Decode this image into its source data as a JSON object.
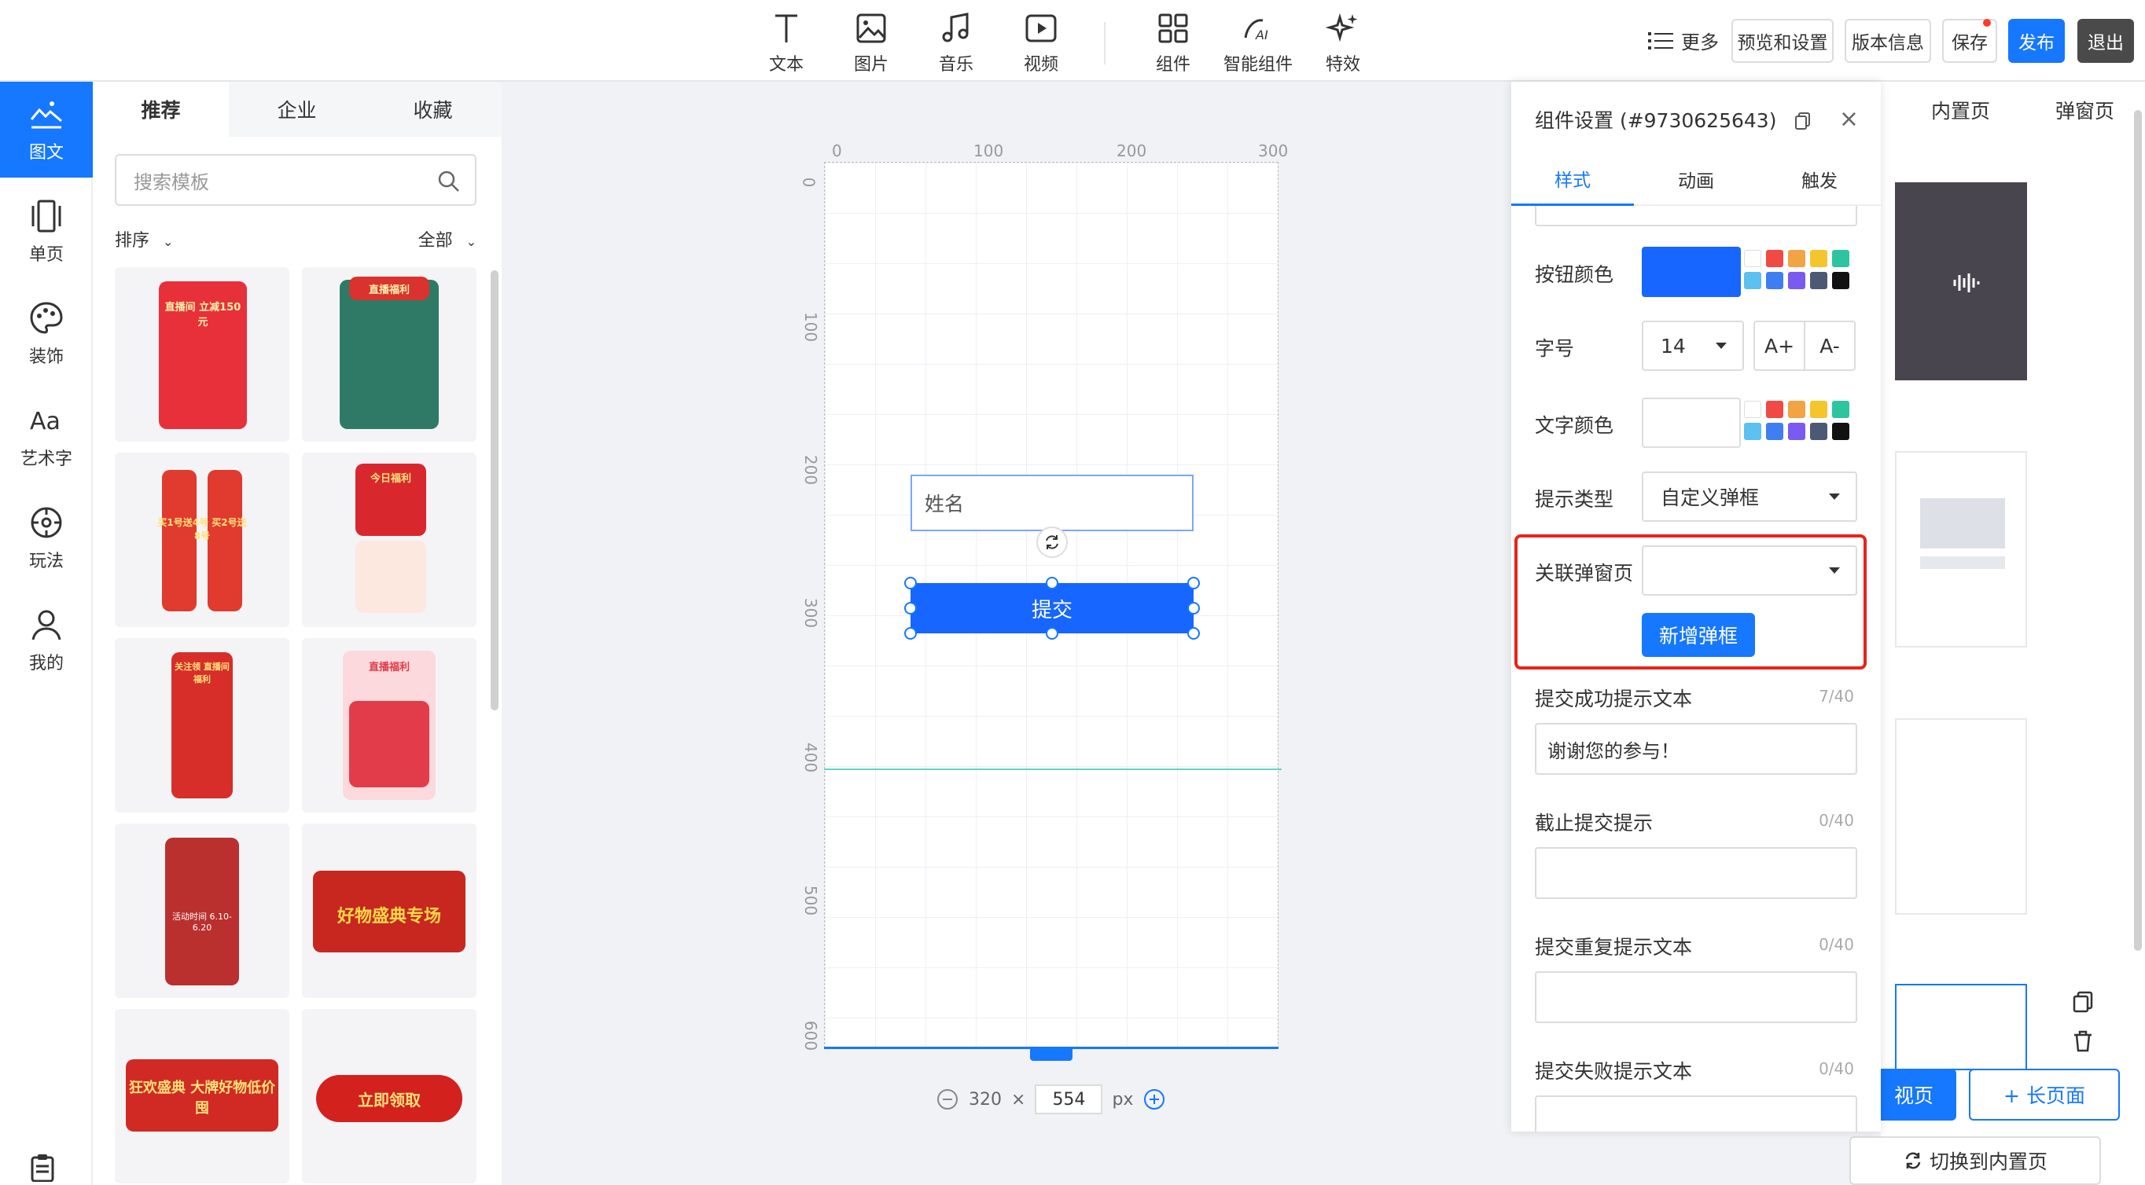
{
  "toolbar": {
    "tools": [
      {
        "label": "文本",
        "icon": "text-icon"
      },
      {
        "label": "图片",
        "icon": "image-icon"
      },
      {
        "label": "音乐",
        "icon": "music-icon"
      },
      {
        "label": "视频",
        "icon": "video-icon"
      },
      {
        "label": "组件",
        "icon": "component-icon"
      },
      {
        "label": "智能组件",
        "icon": "ai-component-icon"
      },
      {
        "label": "特效",
        "icon": "sparkle-icon"
      }
    ],
    "more": "更多",
    "preview": "预览和设置",
    "version": "版本信息",
    "save": "保存",
    "publish": "发布",
    "exit": "退出"
  },
  "leftnav": {
    "items": [
      {
        "label": "图文",
        "icon": "mountain-text-icon"
      },
      {
        "label": "单页",
        "icon": "single-page-icon"
      },
      {
        "label": "装饰",
        "icon": "palette-icon"
      },
      {
        "label": "艺术字",
        "icon": "art-text-icon"
      },
      {
        "label": "玩法",
        "icon": "gameplay-icon"
      },
      {
        "label": "我的",
        "icon": "user-icon"
      }
    ]
  },
  "templates": {
    "tabs": [
      "推荐",
      "企业",
      "收藏"
    ],
    "search_placeholder": "搜索模板",
    "sort": "排序",
    "filter": "全部",
    "cards": [
      {
        "caption": "直播间 立减150元"
      },
      {
        "caption": "直播福利"
      },
      {
        "caption": "买1号送4号 买2号送8号"
      },
      {
        "caption": "今日福利"
      },
      {
        "caption": "关注领 直播间福利"
      },
      {
        "caption": "直播福利"
      },
      {
        "caption": "活动时间 6.10-6.20"
      },
      {
        "caption": "好物盛典专场"
      },
      {
        "caption": "狂欢盛典 大牌好物低价囤"
      },
      {
        "caption": "立即领取"
      }
    ]
  },
  "canvas": {
    "ruler_h": [
      "0",
      "100",
      "200",
      "300"
    ],
    "ruler_v": [
      "0",
      "100",
      "200",
      "300",
      "400",
      "500",
      "600"
    ],
    "name_field": "姓名",
    "submit": "提交",
    "width": "320",
    "height": "554",
    "times": "×",
    "unit": "px"
  },
  "settings": {
    "title": "组件设置 (#9730625643)",
    "tabs": [
      "样式",
      "动画",
      "触发"
    ],
    "button_color_label": "按钮颜色",
    "button_color": "#1766ff",
    "font_size_label": "字号",
    "font_size": "14",
    "font_inc": "A+",
    "font_dec": "A-",
    "text_color_label": "文字颜色",
    "prompt_type_label": "提示类型",
    "prompt_type": "自定义弹框",
    "linked_popup_label": "关联弹窗页",
    "linked_popup": "",
    "add_popup": "新增弹框",
    "success_label": "提交成功提示文本",
    "success_count": "7/40",
    "success_text": "谢谢您的参与！",
    "deadline_label": "截止提交提示",
    "deadline_count": "0/40",
    "duplicate_label": "提交重复提示文本",
    "duplicate_count": "0/40",
    "fail_label": "提交失败提示文本",
    "fail_count": "0/40",
    "palette": [
      "#ffffff",
      "#f04a45",
      "#f2a343",
      "#f5c52e",
      "#2ec4a0",
      "#5cc0f0",
      "#3f7ef2",
      "#7a5af0",
      "#4d5875",
      "#111111"
    ]
  },
  "pages": {
    "tabs": [
      "内置页",
      "弹窗页"
    ],
    "view_btn": "视页",
    "long_page": "+ 长页面",
    "switch": "切换到内置页"
  }
}
